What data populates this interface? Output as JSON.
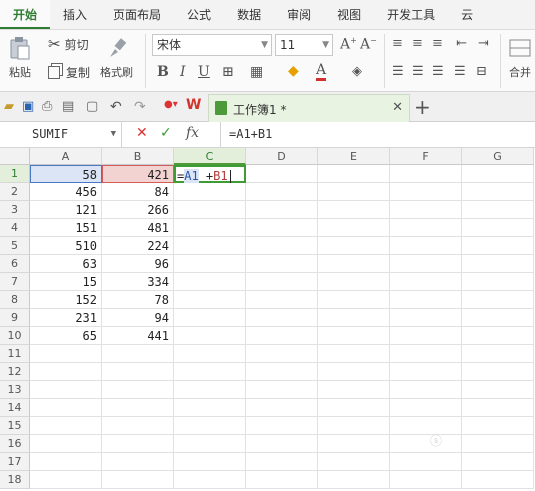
{
  "ribbon_tabs": [
    "开始",
    "插入",
    "页面布局",
    "公式",
    "数据",
    "审阅",
    "视图",
    "开发工具",
    "云"
  ],
  "ribbon": {
    "paste": "粘贴",
    "cut": "剪切",
    "copy": "复制",
    "format_painter": "格式刷",
    "font_name": "宋体",
    "font_size": "11",
    "merge": "合并"
  },
  "doc_tab": {
    "title": "工作簿1 *"
  },
  "formula_bar": {
    "name_box": "SUMIF",
    "formula": "=A1+B1",
    "fx": "fx"
  },
  "columns": [
    "A",
    "B",
    "C",
    "D",
    "E",
    "F",
    "G"
  ],
  "rows": [
    "1",
    "2",
    "3",
    "4",
    "5",
    "6",
    "7",
    "8",
    "9",
    "10",
    "11",
    "12",
    "13",
    "14",
    "15",
    "16",
    "17",
    "18"
  ],
  "cells": {
    "A": [
      "58",
      "456",
      "121",
      "151",
      "510",
      "63",
      "15",
      "152",
      "231",
      "65"
    ],
    "B": [
      "421",
      "84",
      "266",
      "481",
      "224",
      "96",
      "334",
      "78",
      "94",
      "441"
    ]
  },
  "active_cell_edit": {
    "eq": "=",
    "ref_a": "A1",
    "op": " +",
    "ref_b": "B1"
  },
  "colors": {
    "accent": "#2e7d32",
    "ref_a": "#4a78c6",
    "ref_b": "#d15c5c"
  }
}
